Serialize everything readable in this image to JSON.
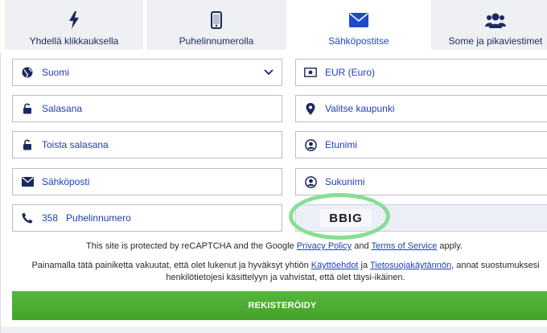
{
  "tabs": [
    {
      "label": "Yhdellä klikkauksella",
      "icon": "lightning-icon",
      "active": false
    },
    {
      "label": "Puhelinnumerolla",
      "icon": "mobile-phone-icon",
      "active": false
    },
    {
      "label": "Sähköpostitse",
      "icon": "envelope-icon",
      "active": true
    },
    {
      "label": "Some ja pikaviestimet",
      "icon": "users-icon",
      "active": false
    }
  ],
  "form": {
    "country": {
      "value": "Suomi",
      "icon": "globe-icon"
    },
    "currency": {
      "value": "EUR (Euro)",
      "icon": "banknote-icon"
    },
    "password": {
      "placeholder": "Salasana",
      "icon": "unlock-icon"
    },
    "city": {
      "placeholder": "Valitse kaupunki",
      "icon": "map-pin-icon"
    },
    "password_repeat": {
      "placeholder": "Toista salasana",
      "icon": "unlock-icon"
    },
    "first_name": {
      "placeholder": "Etunimi",
      "icon": "user-circle-icon"
    },
    "email": {
      "placeholder": "Sähköposti",
      "icon": "envelope-icon"
    },
    "last_name": {
      "placeholder": "Sukunimi",
      "icon": "user-circle-icon"
    },
    "phone": {
      "prefix": "358",
      "placeholder": "Puhelinnumero",
      "icon": "phone-icon"
    },
    "captcha": {
      "text": "BBIG"
    }
  },
  "notes": {
    "recaptcha_prefix": "This site is protected by reCAPTCHA and the Google ",
    "privacy_link": "Privacy Policy",
    "recaptcha_and": " and ",
    "terms_link": "Terms of Service",
    "recaptcha_suffix": " apply.",
    "consent_prefix": "Painamalla tätä painiketta vakuutat, että olet lukenut ja hyväksyt yhtiön ",
    "kayttoehdot_link": "Käyttöehdot",
    "consent_and": " ja ",
    "privacy_fi_link": "Tietosuojakäytännön",
    "consent_suffix_line1": ", annat suostumuksesi",
    "consent_line2": "henkilötietojesi käsittelyyn ja vahvistat, että olet täysi-ikäinen."
  },
  "register_button": "REKISTERÖIDY",
  "colors": {
    "accent": "#1f4ac8",
    "button_green": "#4caf34",
    "highlight": "#86df93"
  }
}
